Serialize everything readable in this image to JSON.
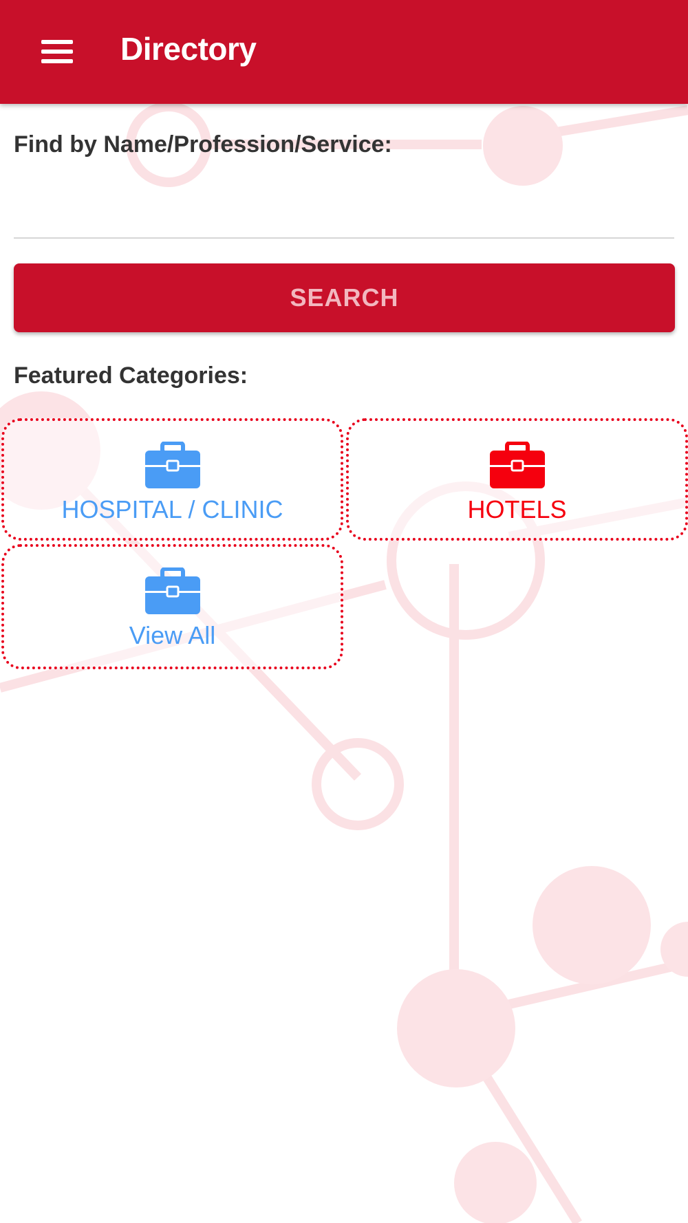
{
  "app_bar": {
    "title": "Directory",
    "menu_icon": "hamburger-menu-icon",
    "background_color": "#c8102a"
  },
  "search": {
    "label": "Find by Name/Profession/Service:",
    "value": "",
    "placeholder": "",
    "button_label": "SEARCH"
  },
  "featured": {
    "label": "Featured Categories:",
    "categories": [
      {
        "label": "HOSPITAL / CLINIC",
        "icon": "briefcase-icon",
        "color": "#4a9cf5"
      },
      {
        "label": "HOTELS",
        "icon": "briefcase-icon",
        "color": "#f5000e"
      },
      {
        "label": "View All",
        "icon": "briefcase-icon",
        "color": "#4a9cf5"
      }
    ]
  },
  "colors": {
    "accent": "#c8102a",
    "category_border": "#e8001c",
    "blue": "#4a9cf5",
    "red": "#f5000e"
  }
}
